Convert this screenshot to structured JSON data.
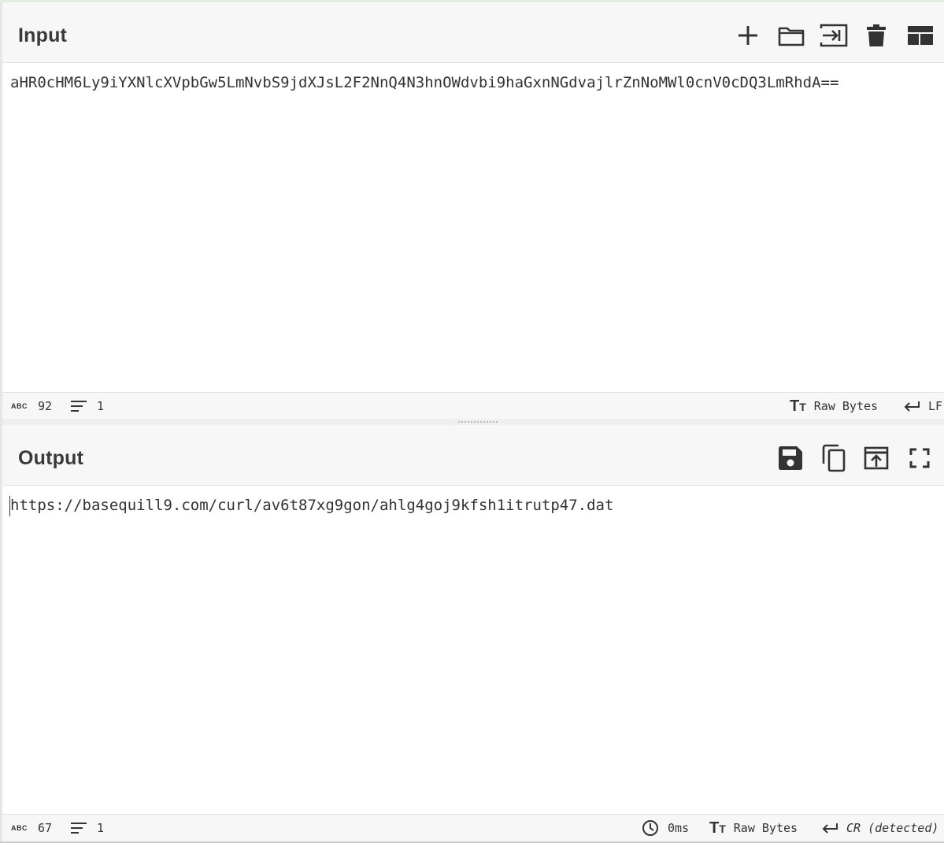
{
  "input": {
    "title": "Input",
    "text": "aHR0cHM6Ly9iYXNlcXVpbGw5LmNvbS9jdXJsL2F2NnQ4N3hnOWdvbi9haGxnNGdvajlrZnNoMWl0cnV0cDQ3LmRhdA==",
    "toolbar": [
      "plus-icon",
      "folder-icon",
      "import-icon",
      "trash-icon",
      "layout-icon"
    ],
    "status": {
      "length": "92",
      "lines": "1",
      "encoding": "Raw Bytes",
      "eol": "LF"
    }
  },
  "output": {
    "title": "Output",
    "text": "https://basequill9.com/curl/av6t87xg9gon/ahlg4goj9kfsh1itrutp47.dat",
    "toolbar": [
      "save-icon",
      "copy-icon",
      "replace-input-icon",
      "fullscreen-icon"
    ],
    "status": {
      "length": "67",
      "lines": "1",
      "time": "0ms",
      "encoding": "Raw Bytes",
      "eol": "CR (detected)"
    }
  },
  "icons": {
    "length_glyph": "ABC",
    "encoding_glyph": "TT"
  }
}
